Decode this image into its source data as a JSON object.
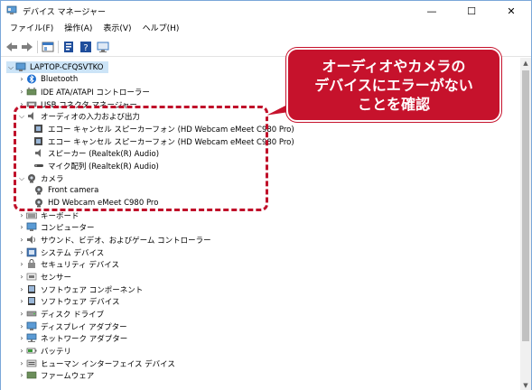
{
  "window": {
    "title": "デバイス マネージャー",
    "controls": {
      "minimize": "—",
      "maximize": "☐",
      "close": "✕"
    }
  },
  "menu": [
    "ファイル(F)",
    "操作(A)",
    "表示(V)",
    "ヘルプ(H)"
  ],
  "toolbar": {
    "icons": [
      "back-arrow-icon",
      "forward-arrow-icon",
      "properties-icon",
      "help-icon",
      "device-list-icon",
      "monitor-icon"
    ]
  },
  "tree": {
    "root": "LAPTOP-CFQSVTKO",
    "items": [
      {
        "label": "Bluetooth",
        "icon": "bluetooth-icon",
        "expanded": false
      },
      {
        "label": "IDE ATA/ATAPI コントローラー",
        "icon": "ide-controller-icon",
        "expanded": false
      },
      {
        "label": "USB コネクタ マネージャー",
        "icon": "usb-icon",
        "expanded": false
      },
      {
        "label": "オーディオの入力および出力",
        "icon": "speaker-icon",
        "expanded": true,
        "children": [
          {
            "label": "エコー キャンセル スピーカーフォン (HD Webcam eMeet C980 Pro)",
            "icon": "speaker-icon"
          },
          {
            "label": "エコー キャンセル スピーカーフォン (HD Webcam eMeet C980 Pro)",
            "icon": "speaker-icon"
          },
          {
            "label": "スピーカー (Realtek(R) Audio)",
            "icon": "speaker-icon"
          },
          {
            "label": "マイク配列 (Realtek(R) Audio)",
            "icon": "microphone-icon"
          }
        ]
      },
      {
        "label": "カメラ",
        "icon": "camera-icon",
        "expanded": true,
        "children": [
          {
            "label": "Front camera",
            "icon": "camera-icon"
          },
          {
            "label": "HD Webcam eMeet C980 Pro",
            "icon": "camera-icon"
          }
        ]
      },
      {
        "label": "キーボード",
        "icon": "keyboard-icon",
        "expanded": false
      },
      {
        "label": "コンピューター",
        "icon": "computer-icon",
        "expanded": false
      },
      {
        "label": "サウンド、ビデオ、およびゲーム コントローラー",
        "icon": "sound-icon",
        "expanded": false
      },
      {
        "label": "システム デバイス",
        "icon": "system-device-icon",
        "expanded": false
      },
      {
        "label": "セキュリティ デバイス",
        "icon": "security-device-icon",
        "expanded": false
      },
      {
        "label": "センサー",
        "icon": "sensor-icon",
        "expanded": false
      },
      {
        "label": "ソフトウェア コンポーネント",
        "icon": "software-component-icon",
        "expanded": false
      },
      {
        "label": "ソフトウェア デバイス",
        "icon": "software-device-icon",
        "expanded": false
      },
      {
        "label": "ディスク ドライブ",
        "icon": "disk-drive-icon",
        "expanded": false
      },
      {
        "label": "ディスプレイ アダプター",
        "icon": "display-adapter-icon",
        "expanded": false
      },
      {
        "label": "ネットワーク アダプター",
        "icon": "network-adapter-icon",
        "expanded": false
      },
      {
        "label": "バッテリ",
        "icon": "battery-icon",
        "expanded": false
      },
      {
        "label": "ヒューマン インターフェイス デバイス",
        "icon": "hid-icon",
        "expanded": false
      },
      {
        "label": "ファームウェア",
        "icon": "firmware-icon",
        "expanded": false
      }
    ]
  },
  "callout": {
    "lines": [
      "オーディオやカメラの",
      "デバイスにエラーがない",
      "ことを確認"
    ],
    "color": "#c6122c"
  },
  "colors": {
    "selection": "#cce4f7",
    "accent": "#c0102a"
  }
}
